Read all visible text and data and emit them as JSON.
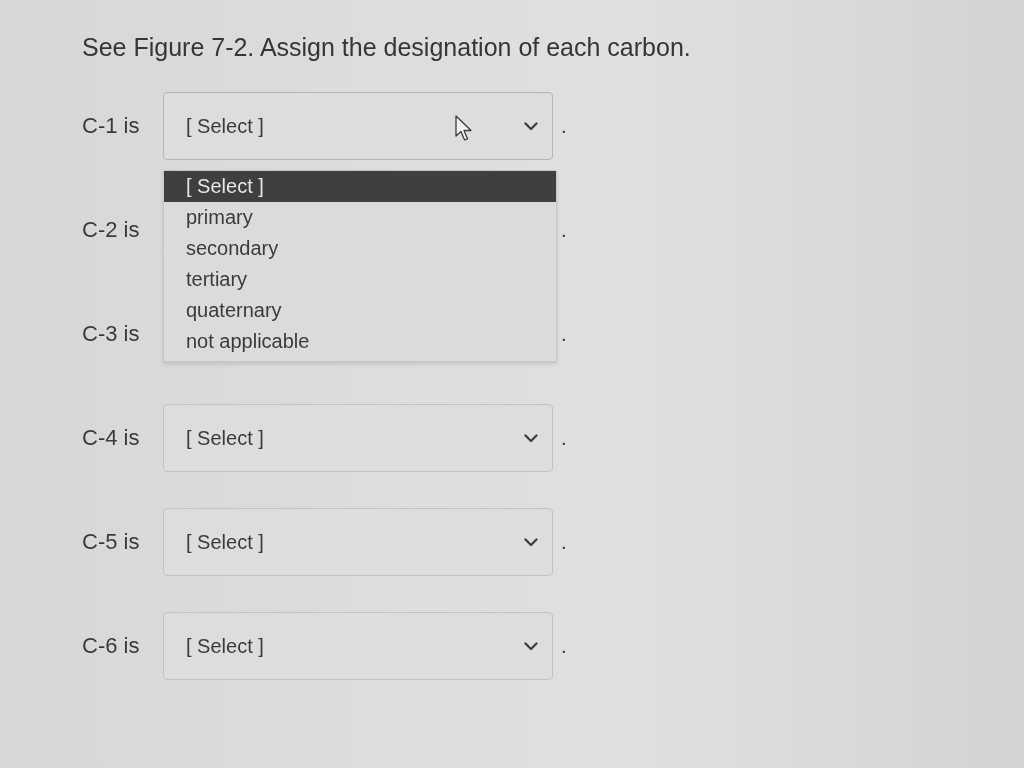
{
  "question": "See Figure 7-2. Assign the designation of each carbon.",
  "rows": [
    {
      "label": "C-1 is",
      "value": "[ Select ]",
      "expanded": true,
      "options": [
        {
          "label": "[ Select ]",
          "selected": true
        },
        {
          "label": "primary",
          "selected": false
        },
        {
          "label": "secondary",
          "selected": false
        },
        {
          "label": "tertiary",
          "selected": false
        },
        {
          "label": "quaternary",
          "selected": false
        },
        {
          "label": "not applicable",
          "selected": false
        }
      ],
      "suffix": "."
    },
    {
      "label": "C-2 is",
      "suffix": "."
    },
    {
      "label": "C-3 is",
      "suffix": "."
    },
    {
      "label": "C-4 is",
      "value": "[ Select ]",
      "expanded": false,
      "suffix": "."
    },
    {
      "label": "C-5 is",
      "value": "[ Select ]",
      "expanded": false,
      "suffix": "."
    },
    {
      "label": "C-6 is",
      "value": "[ Select ]",
      "expanded": false,
      "suffix": "."
    }
  ]
}
